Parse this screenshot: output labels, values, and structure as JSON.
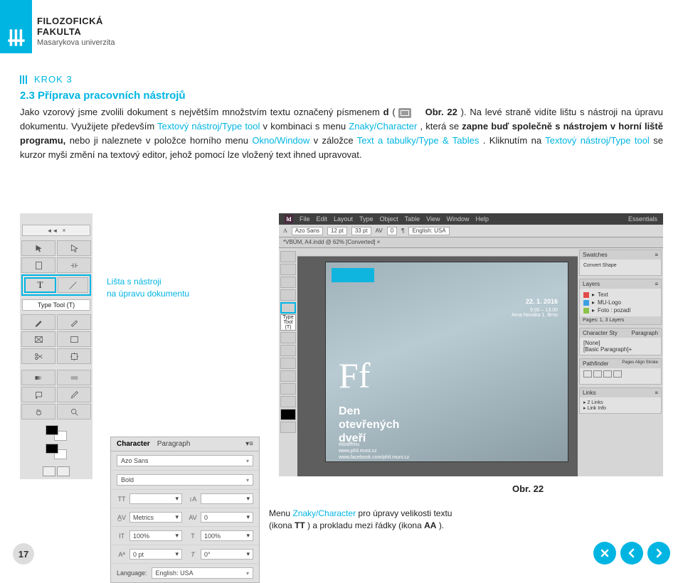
{
  "faculty": {
    "line1": "FILOZOFICKÁ",
    "line2": "FAKULTA",
    "line3": "Masarykova univerzita"
  },
  "krok_label": "KROK 3",
  "section_title": "2.3 Příprava pracovních nástrojů",
  "body": {
    "p1a": "Jako vzorový jsme zvolili dokument s největším množstvím textu označený písmenem ",
    "p1b_bold": "d",
    "p1c": "  (",
    "p1d_bold": "Obr. 22",
    "p1e": "). Na levé straně vidíte lištu s nástroji na úpravu dokumentu. Využijete především ",
    "t1_link": "Textový nástroj/Type tool",
    "p1f": "  v kombinaci s menu ",
    "t2_link": "Znaky/Character",
    "p1g": ", která se ",
    "p1g_bold": "zapne buď společně s nástrojem v horní liště programu,",
    "p1h": " nebo ji naleznete v položce horního menu ",
    "t3_link": "Okno/Window",
    "p1i": " v záložce ",
    "t4_link": "Text a tabulky/Type & Tables",
    "p1j": ". Kliknutím na ",
    "t5_link": "Textový nástroj/Type tool",
    "p1k": " se kurzor myši změní na textový editor, jehož pomocí lze vložený text ihned upravovat."
  },
  "tool_callout": {
    "l1": "Lišta s nástroji",
    "l2": "na úpravu dokumentu"
  },
  "tool_panel": {
    "header_arrows": "◄◄",
    "header_x": "×",
    "type_tool_label": "Type Tool (T)"
  },
  "char_panel": {
    "tab1": "Character",
    "tab2": "Paragraph",
    "font": "Azo Sans",
    "weight": "Bold",
    "metrics": "Metrics",
    "av": "0",
    "tt_size": "",
    "leading": "",
    "it_pct": "100%",
    "t_pct": "100%",
    "aa": "0 pt",
    "t_deg": "0°",
    "lang_label": "Language:",
    "lang_val": "English: USA"
  },
  "id_shot": {
    "menu": [
      "File",
      "Edit",
      "Layout",
      "Type",
      "Object",
      "Table",
      "View",
      "Window",
      "Help"
    ],
    "essentials": "Essentials",
    "ctrl_items": [
      "Azo Sans",
      "12 pt",
      "33 pt",
      "0",
      "English: USA"
    ],
    "tab_label": "*VBÚM, A4.indd @ 62% [Converted]",
    "ttlab": "Type Tool (T)",
    "page": {
      "date": "22. 1. 2016",
      "addr1": "9.00 – 13.00",
      "addr2": "Arna Nováka 1, Brno",
      "ff": "Ff",
      "h1a": "Den",
      "h1b": "otevřených",
      "h1c": "dveří",
      "sub1": "#dodffmu",
      "sub2": "www.phil.muni.cz",
      "sub3": "www.facebook.com/phil.muni.cz"
    },
    "panels": {
      "swatches_title": "Swatches",
      "swatches_btn1": "Convert Shape",
      "layers_title": "Layers",
      "layers": [
        {
          "name": "Text",
          "color": "#e34a4a"
        },
        {
          "name": "MU-Logo",
          "color": "#3aa0e3"
        },
        {
          "name": "Foto : pozadí",
          "color": "#8bc34a"
        }
      ],
      "layers_count": "Pages: 1, 3 Layers",
      "char_title": "Character Sty",
      "char_tab2": "Paragraph",
      "char_item1": "[None]",
      "char_item2": "[Basic Paragraph]+",
      "path_title": "Pathfinder",
      "path_tab2": "Pages Align Stroke",
      "links_title": "Links",
      "links_item": "Link Info"
    }
  },
  "obr_label": "Obr. 22",
  "bottom_caption": {
    "a": "Menu ",
    "b_link": "Znaky/Character",
    "c": " pro úpravy velikosti textu",
    "d": "(ikona ",
    "e_bold": "TT",
    "f": ") a prokladu mezi řádky (ikona ",
    "g_bold": "AA",
    "h": ")."
  },
  "page_num": "17"
}
